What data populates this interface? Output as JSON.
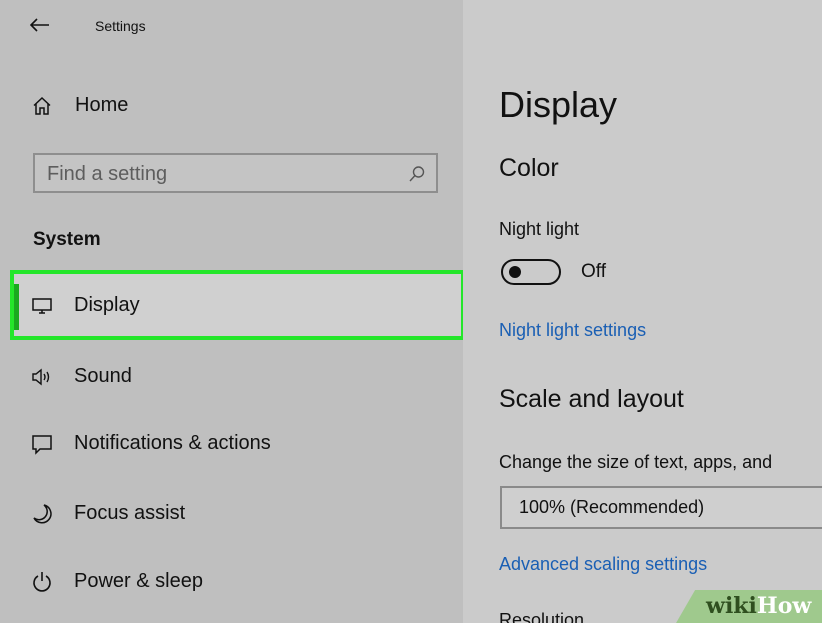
{
  "window": {
    "title": "Settings"
  },
  "sidebar": {
    "home_label": "Home",
    "search": {
      "placeholder": "Find a setting",
      "value": ""
    },
    "section_header": "System",
    "items": [
      {
        "label": "Display",
        "icon": "monitor-icon",
        "selected": true
      },
      {
        "label": "Sound",
        "icon": "speaker-icon",
        "selected": false
      },
      {
        "label": "Notifications & actions",
        "icon": "notification-icon",
        "selected": false
      },
      {
        "label": "Focus assist",
        "icon": "moon-icon",
        "selected": false
      },
      {
        "label": "Power & sleep",
        "icon": "power-icon",
        "selected": false
      }
    ]
  },
  "main": {
    "page_title": "Display",
    "color_section": {
      "heading": "Color",
      "night_light_label": "Night light",
      "night_light_state": "Off",
      "night_light_on": false,
      "night_light_settings_link": "Night light settings"
    },
    "scale_section": {
      "heading": "Scale and layout",
      "description": "Change the size of text, apps, and",
      "scale_value": "100% (Recommended)",
      "advanced_link": "Advanced scaling settings",
      "resolution_label": "Resolution"
    }
  },
  "watermark": {
    "part1": "wiki",
    "part2": "How"
  },
  "colors": {
    "selection_highlight": "#24e62a",
    "link": "#1a5fb4",
    "sidebar_bg": "#bfbfbf",
    "main_bg": "#cbcbcb"
  }
}
